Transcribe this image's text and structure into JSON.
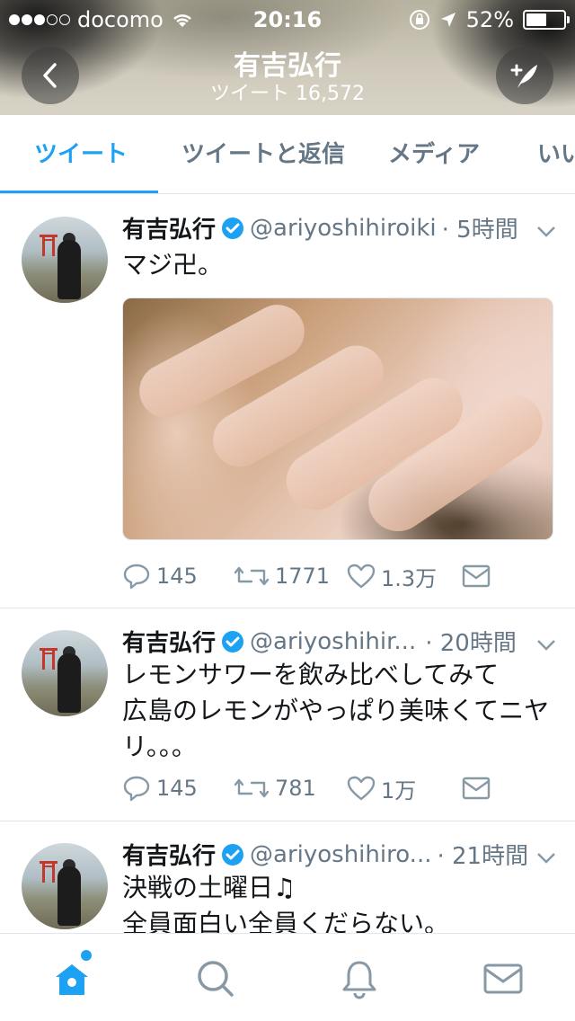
{
  "status_bar": {
    "carrier": "docomo",
    "time": "20:16",
    "battery_percent": "52%"
  },
  "header": {
    "title": "有吉弘行",
    "subtitle": "ツイート 16,572"
  },
  "tabs": [
    {
      "label": "ツイート",
      "active": true
    },
    {
      "label": "ツイートと返信",
      "active": false
    },
    {
      "label": "メディア",
      "active": false
    },
    {
      "label": "いいね",
      "active": false
    }
  ],
  "tweets": [
    {
      "name": "有吉弘行",
      "handle": "@ariyoshihiroiki",
      "time": "· 5時間",
      "text": "マジ卍。",
      "has_media": true,
      "replies": "145",
      "retweets": "1771",
      "likes": "1.3万"
    },
    {
      "name": "有吉弘行",
      "handle": "@ariyoshihir...",
      "time": "· 20時間",
      "text_lines": [
        "レモンサワーを飲み比べしてみて",
        "広島のレモンがやっぱり美味くてニヤ",
        "リ。。。"
      ],
      "replies": "145",
      "retweets": "781",
      "likes": "1万"
    },
    {
      "name": "有吉弘行",
      "handle": "@ariyoshihiro...",
      "time": "· 21時間",
      "text_lines": [
        "決戦の土曜日♫",
        "全員面白い全員くだらない。"
      ]
    }
  ],
  "colors": {
    "accent": "#1da1f2",
    "text_primary": "#14171a",
    "text_secondary": "#657786",
    "divider": "#e1e8ed"
  }
}
